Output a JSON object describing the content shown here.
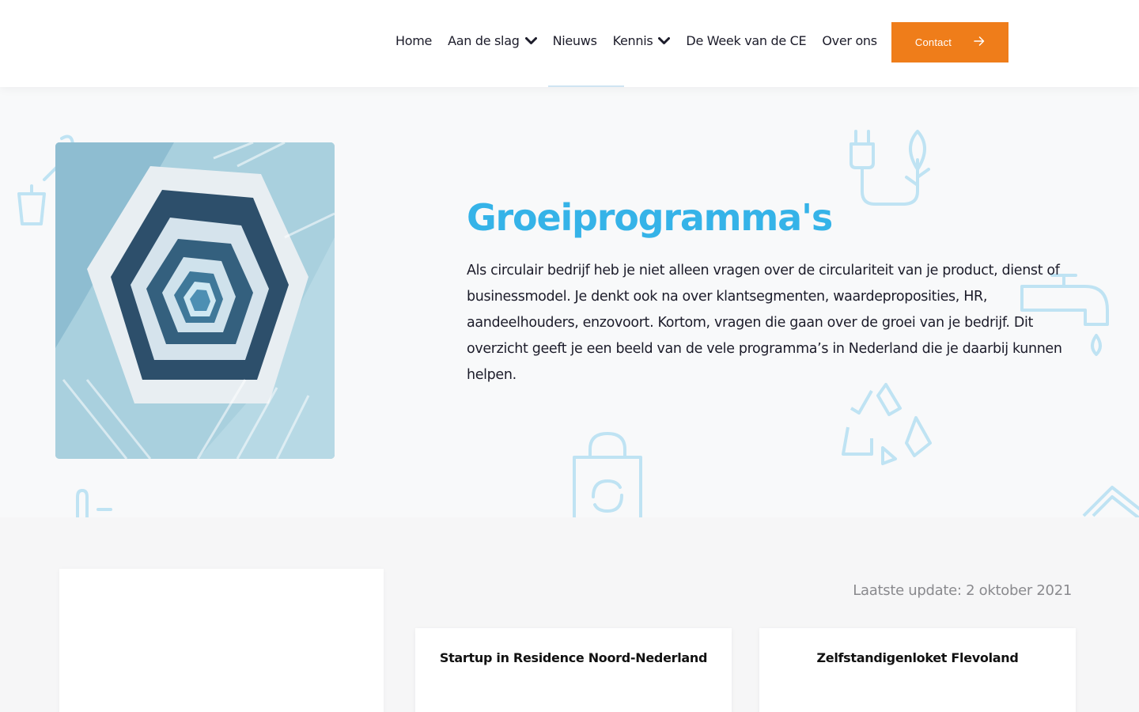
{
  "header": {
    "nav": [
      {
        "label": "Home",
        "dropdown": false
      },
      {
        "label": "Aan de slag",
        "dropdown": true
      },
      {
        "label": "Nieuws",
        "dropdown": false
      },
      {
        "label": "Kennis",
        "dropdown": true
      },
      {
        "label": "De Week van de CE",
        "dropdown": false
      },
      {
        "label": "Over ons",
        "dropdown": false
      }
    ],
    "contact_label": "Contact"
  },
  "hero": {
    "title": "Groeiprogramma's",
    "text": "Als circulair bedrijf heb je niet alleen vragen over de circulariteit van je product, dienst of businessmodel. Je denkt ook na over klantsegmenten, waardeproposities, HR, aandeelhouders, enzovoort. Kortom, vragen die gaan over de groei van je bedrijf. Dit overzicht geeft je een beeld van de vele programma’s in Nederland die je daarbij kunnen helpen."
  },
  "main": {
    "last_update": "Laatste update: 2 oktober 2021",
    "cards": [
      {
        "title": "Startup in Residence Noord-Nederland"
      },
      {
        "title": "Zelfstandigenloket Flevoland"
      }
    ]
  },
  "colors": {
    "accent": "#35b3e8",
    "button": "#ef7d1a",
    "icon_outline": "#bfe3f3"
  }
}
